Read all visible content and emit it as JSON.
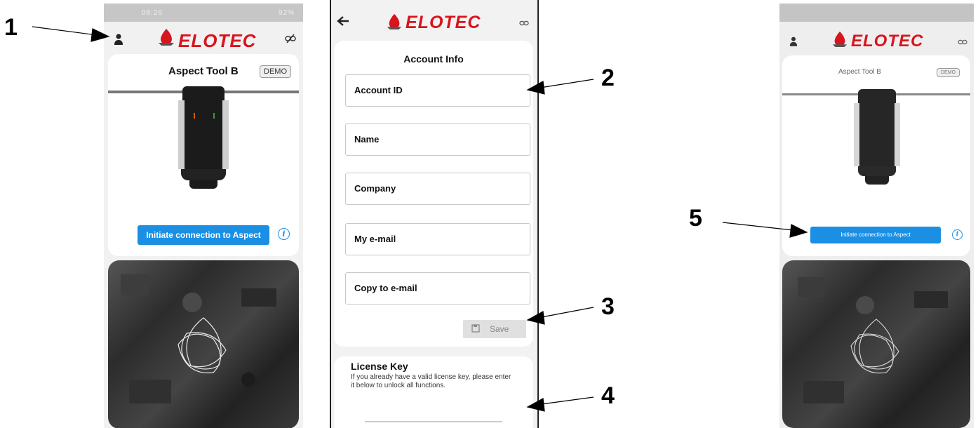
{
  "callouts": [
    "1",
    "2",
    "3",
    "4",
    "5"
  ],
  "phone1": {
    "status_time": "08:26",
    "status_right": "92%",
    "logo_text": "ELOTEC",
    "device_title": "Aspect Tool B",
    "demo_badge": "DEMO",
    "connect_button": "Initiate connection to Aspect",
    "info_glyph": "i"
  },
  "phone2": {
    "logo_text": "ELOTEC",
    "section_title": "Account Info",
    "fields": [
      "Account ID",
      "Name",
      "Company",
      "My e-mail",
      "Copy to e-mail"
    ],
    "save_button": "Save",
    "license_title": "License Key",
    "license_text": "If you already have a valid license key, please enter it below to unlock all functions."
  },
  "phone3": {
    "logo_text": "ELOTEC",
    "device_title": "Aspect Tool B",
    "demo_badge": "DEMO",
    "connect_button": "Initiate connection to Aspect",
    "info_glyph": "i"
  },
  "icons": {
    "account": "person-icon",
    "back": "back-arrow-icon",
    "link": "link-off-icon",
    "save": "save-icon",
    "info": "info-icon"
  },
  "colors": {
    "accent_blue": "#1a8fe3",
    "logo_red": "#d8141d"
  }
}
